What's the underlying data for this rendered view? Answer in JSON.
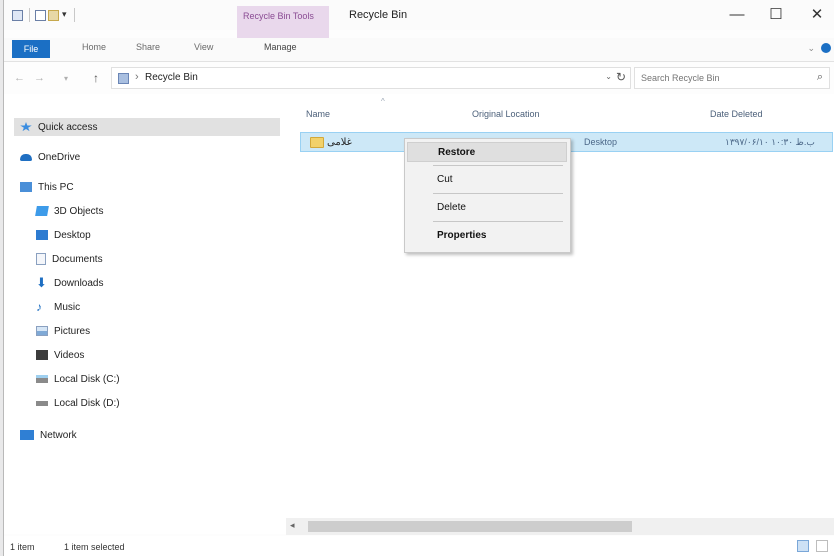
{
  "titlebar": {
    "context_tab_group": "Recycle Bin Tools",
    "window_title": "Recycle Bin",
    "minimize": "—",
    "maximize": "☐",
    "close": "✕",
    "quick_access_dropdown": "▾"
  },
  "ribbon": {
    "tabs": {
      "file": "File",
      "home": "Home",
      "share": "Share",
      "view": "View",
      "manage": "Manage"
    },
    "collapse_glyph": "⌄"
  },
  "address": {
    "back": "←",
    "forward": "→",
    "up": "↑",
    "separator": "›",
    "path": "Recycle Bin",
    "dropdown": "⌄",
    "refresh": "↻"
  },
  "search": {
    "placeholder": "Search Recycle Bin",
    "icon": "⌕"
  },
  "navpane": {
    "items": [
      {
        "label": "Quick access",
        "icon": "star-icon"
      },
      {
        "label": "OneDrive",
        "icon": "cloud-icon"
      },
      {
        "label": "This PC",
        "icon": "computer-icon"
      },
      {
        "label": "3D Objects",
        "icon": "cube-icon"
      },
      {
        "label": "Desktop",
        "icon": "desktop-icon"
      },
      {
        "label": "Documents",
        "icon": "document-icon"
      },
      {
        "label": "Downloads",
        "icon": "download-icon"
      },
      {
        "label": "Music",
        "icon": "music-icon"
      },
      {
        "label": "Pictures",
        "icon": "pictures-icon"
      },
      {
        "label": "Videos",
        "icon": "video-icon"
      },
      {
        "label": "Local Disk (C:)",
        "icon": "drive-icon"
      },
      {
        "label": "Local Disk (D:)",
        "icon": "drive-icon"
      },
      {
        "label": "Network",
        "icon": "network-icon"
      }
    ]
  },
  "list": {
    "columns": {
      "name": "Name",
      "original_location": "Original Location",
      "date_deleted": "Date Deleted"
    },
    "sort_caret": "^",
    "rows": [
      {
        "name": "غلامی",
        "original_location": "Desktop",
        "date_deleted": "۱۳۹۷/۰۶/۱۰ ب.ظ ۱۰:۳۰"
      }
    ]
  },
  "context_menu": {
    "items": [
      "Restore",
      "Cut",
      "Delete",
      "Properties"
    ]
  },
  "scrollbar": {
    "left_arrow": "◂"
  },
  "status": {
    "item_count": "1 item",
    "selected": "1 item selected"
  },
  "colors": {
    "accent": "#1b6fc4",
    "selection_bg": "#cde8f7",
    "context_tab": "#e9d8ec"
  }
}
